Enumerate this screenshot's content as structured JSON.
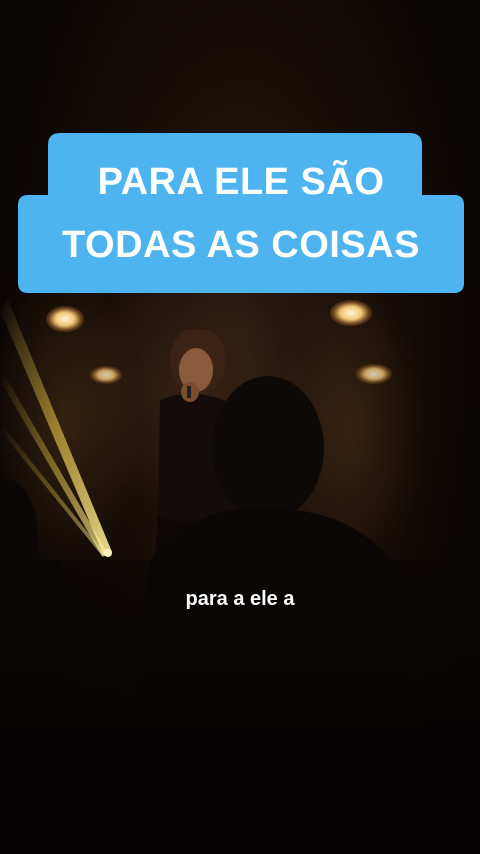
{
  "overlay_title": {
    "line1": "PARA ELE SÃO",
    "line2": "TODAS AS COISAS",
    "background_color": "#4db4ef",
    "text_color": "#ffffff"
  },
  "subtitle": {
    "text": "para a ele a"
  }
}
